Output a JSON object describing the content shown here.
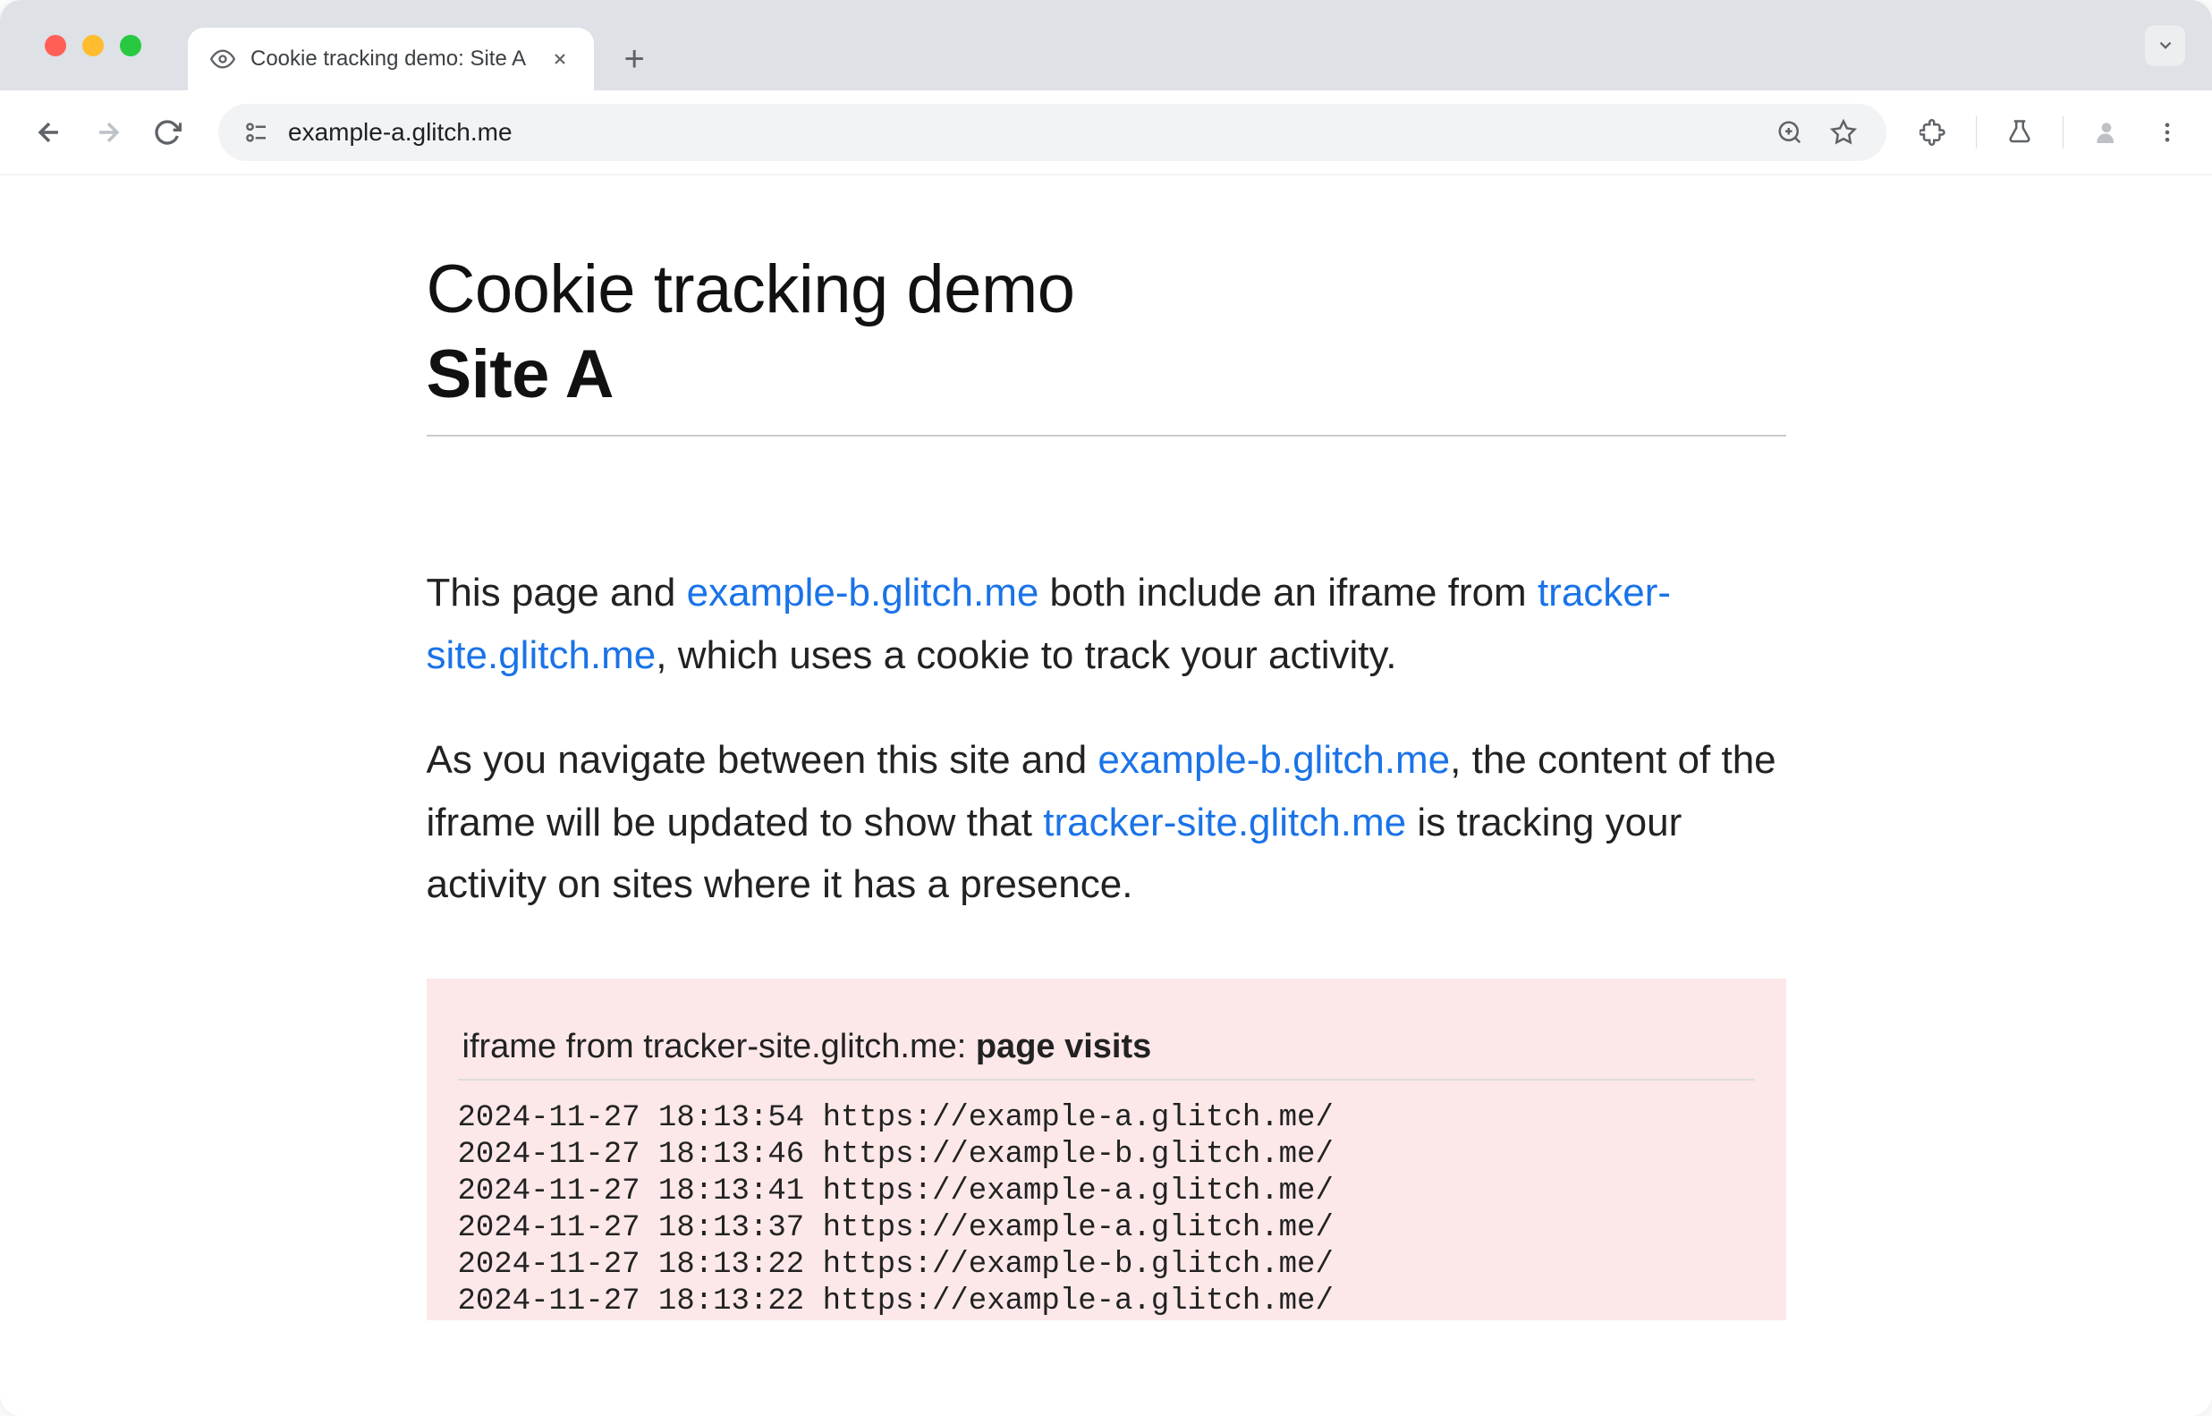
{
  "browser": {
    "tab_title": "Cookie tracking demo: Site A",
    "url": "example-a.glitch.me"
  },
  "page": {
    "title_line1": "Cookie tracking demo",
    "title_line2": "Site A",
    "para1_a": "This page and ",
    "para1_link1": "example-b.glitch.me",
    "para1_b": " both include an iframe from ",
    "para1_link2": "tracker-site.glitch.me",
    "para1_c": ", which uses a cookie to track your activity.",
    "para2_a": "As you navigate between this site and ",
    "para2_link1": "example-b.glitch.me",
    "para2_b": ", the content of the iframe will be updated to show that ",
    "para2_link2": "tracker-site.glitch.me",
    "para2_c": " is tracking your activity on sites where it has a presence."
  },
  "iframe": {
    "heading_a": "iframe from tracker-site.glitch.me: ",
    "heading_b": "page visits",
    "logs": [
      "2024-11-27 18:13:54 https://example-a.glitch.me/",
      "2024-11-27 18:13:46 https://example-b.glitch.me/",
      "2024-11-27 18:13:41 https://example-a.glitch.me/",
      "2024-11-27 18:13:37 https://example-a.glitch.me/",
      "2024-11-27 18:13:22 https://example-b.glitch.me/",
      "2024-11-27 18:13:22 https://example-a.glitch.me/"
    ]
  }
}
